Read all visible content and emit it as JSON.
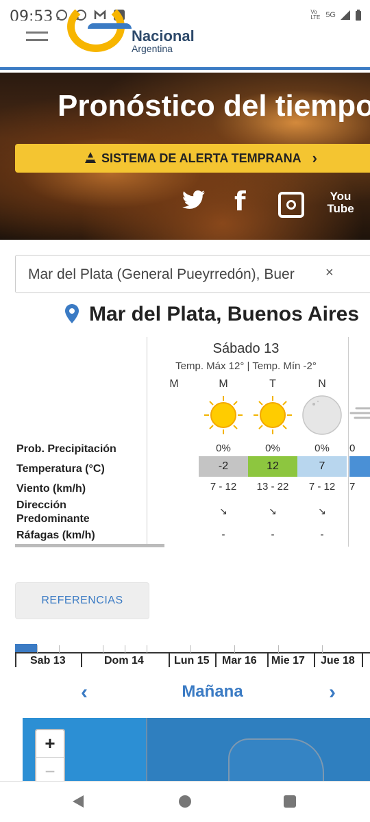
{
  "status": {
    "time": "09:53",
    "network": "5G",
    "volte": "Vo LTE"
  },
  "header": {
    "logo_line1": "Nacional",
    "logo_line2": "Argentina"
  },
  "hero": {
    "title": "Pronóstico del tiempo",
    "alert_label": "SISTEMA DE ALERTA TEMPRANA",
    "social": {
      "facebook": "f",
      "youtube_top": "You",
      "youtube_bottom": "Tube"
    }
  },
  "search": {
    "value": "Mar del Plata (General Pueyrredón), Buer",
    "clear": "×"
  },
  "location": {
    "title": "Mar del Plata, Buenos Aires"
  },
  "forecast": {
    "row_labels": {
      "precip": "Prob. Precipitación",
      "temp": "Temperatura (°C)",
      "wind": "Viento (km/h)",
      "direction_1": "Dirección",
      "direction_2": "Predominante",
      "gusts": "Ráfagas (km/h)"
    },
    "day": {
      "title": "Sábado 13",
      "subtitle": "Temp. Máx 12° | Temp. Mín -2°"
    },
    "periods": [
      {
        "label": "M",
        "icon": "none",
        "precip": "",
        "temp": "",
        "temp_color": "",
        "wind": "",
        "direction": "",
        "gusts": ""
      },
      {
        "label": "M",
        "icon": "sun-icon",
        "precip": "0%",
        "temp": "-2",
        "temp_color": "#c4c4c4",
        "wind": "7 - 12",
        "direction": "↘",
        "gusts": "-"
      },
      {
        "label": "T",
        "icon": "sun-icon",
        "precip": "0%",
        "temp": "12",
        "temp_color": "#8dc63f",
        "wind": "13 - 22",
        "direction": "↘",
        "gusts": "-"
      },
      {
        "label": "N",
        "icon": "moon-icon",
        "precip": "0%",
        "temp": "7",
        "temp_color": "#b8d6ee",
        "wind": "7 - 12",
        "direction": "↘",
        "gusts": "-"
      }
    ],
    "next_col": {
      "precip": "0",
      "wind": "7",
      "temp_color": "#4a90d6"
    }
  },
  "references": {
    "label": "REFERENCIAS"
  },
  "timeline": {
    "days": [
      "Sab 13",
      "Dom 14",
      "Lun 15",
      "Mar 16",
      "Mie 17",
      "Jue 18"
    ]
  },
  "day_nav": {
    "label": "Mañana",
    "prev": "‹",
    "next": "›"
  },
  "map": {
    "zoom_in": "+",
    "zoom_out": "−"
  },
  "colors": {
    "accent": "#3b7bc4",
    "alert": "#f4c531"
  }
}
